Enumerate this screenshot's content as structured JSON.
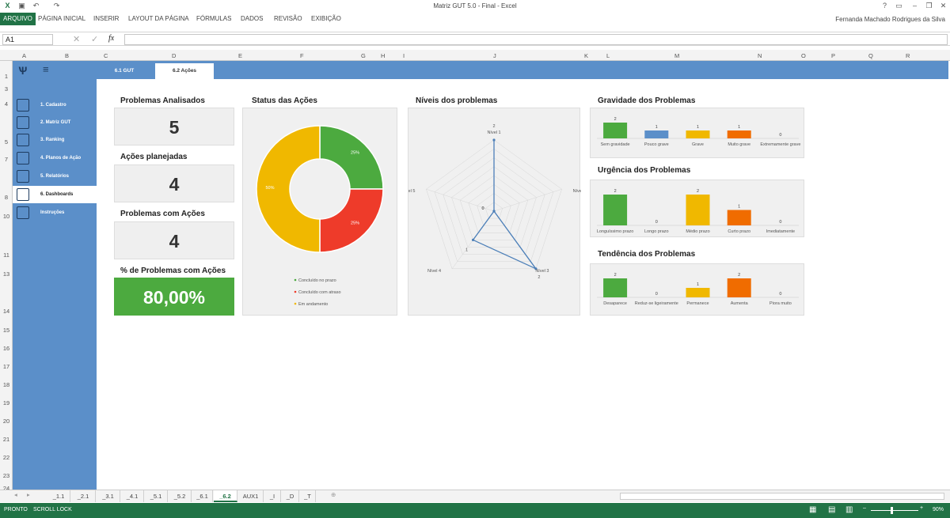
{
  "window": {
    "title": "Matriz GUT 5.0 - Final - Excel",
    "user": "Fernanda Machado Rodrigues da Silva"
  },
  "ribbon": {
    "tabs": [
      "ARQUIVO",
      "PÁGINA INICIAL",
      "INSERIR",
      "LAYOUT DA PÁGINA",
      "FÓRMULAS",
      "DADOS",
      "REVISÃO",
      "EXIBIÇÃO"
    ]
  },
  "formula_bar": {
    "name_box": "A1",
    "fx": "fx",
    "content": ""
  },
  "columns": [
    "A",
    "B",
    "C",
    "D",
    "E",
    "F",
    "G",
    "H",
    "I",
    "J",
    "K",
    "L",
    "M",
    "N",
    "O",
    "P",
    "Q",
    "R"
  ],
  "rows": [
    "1",
    "3",
    "4",
    "5",
    "7",
    "8",
    "10",
    "11",
    "13",
    "14",
    "15",
    "16",
    "17",
    "18",
    "19",
    "20",
    "21",
    "22",
    "23",
    "24"
  ],
  "sidebar": {
    "items": [
      {
        "label": "1. Cadastro",
        "icon": "register-icon"
      },
      {
        "label": "2. Matriz GUT",
        "icon": "matrix-icon"
      },
      {
        "label": "3. Ranking",
        "icon": "ranking-icon"
      },
      {
        "label": "4. Planos de Ação",
        "icon": "action-plan-icon"
      },
      {
        "label": "5. Relatórios",
        "icon": "report-icon"
      },
      {
        "label": "6. Dashboards",
        "icon": "dashboard-icon"
      },
      {
        "label": "Instruções",
        "icon": "instructions-icon"
      }
    ],
    "active_index": 5
  },
  "subtabs": [
    {
      "label": "6.1 GUT"
    },
    {
      "label": "6.2 Ações"
    }
  ],
  "subtab_active": 1,
  "kpis": {
    "analisados": {
      "title": "Problemas Analisados",
      "value": "5"
    },
    "planejadas": {
      "title": "Ações planejadas",
      "value": "4"
    },
    "com_acoes": {
      "title": "Problemas com Ações",
      "value": "4"
    },
    "pct": {
      "title": "% de Problemas com Ações",
      "value": "80,00%"
    }
  },
  "colors": {
    "green": "#4caa3f",
    "yellow": "#f0b800",
    "red": "#ee3b2a",
    "blue": "#5b8fc9",
    "orange": "#f06c00",
    "excel_green": "#217346"
  },
  "chart_data": [
    {
      "type": "pie",
      "title": "Status das Ações",
      "categories": [
        "Concluído no prazo",
        "Concluído com atraso",
        "Em andamento"
      ],
      "values": [
        25,
        25,
        50
      ],
      "value_labels": [
        "25%",
        "25%",
        "50%"
      ],
      "colors": [
        "#4caa3f",
        "#ee3b2a",
        "#f0b800"
      ],
      "legend": "bottom"
    },
    {
      "type": "radar",
      "title": "Níveis dos problemas",
      "categories": [
        "Nível 1",
        "Nível 2",
        "Nível 3",
        "Nível 4",
        "Nível 5"
      ],
      "values": [
        2,
        0,
        2,
        1,
        0
      ],
      "rlim": [
        0,
        2
      ]
    },
    {
      "type": "bar",
      "title": "Gravidade dos Problemas",
      "categories": [
        "Sem gravidade",
        "Pouco grave",
        "Grave",
        "Muito grave",
        "Extremamente grave"
      ],
      "values": [
        2,
        1,
        1,
        1,
        0
      ],
      "colors": [
        "#4caa3f",
        "#5b8fc9",
        "#f0b800",
        "#f06c00",
        "#ee3b2a"
      ],
      "ylim": [
        0,
        2
      ]
    },
    {
      "type": "bar",
      "title": "Urgência dos Problemas",
      "categories": [
        "Longuíssimo prazo",
        "Longo prazo",
        "Médio prazo",
        "Curto prazo",
        "Imediatamente"
      ],
      "values": [
        2,
        0,
        2,
        1,
        0
      ],
      "colors": [
        "#4caa3f",
        "#5b8fc9",
        "#f0b800",
        "#f06c00",
        "#ee3b2a"
      ],
      "ylim": [
        0,
        2
      ]
    },
    {
      "type": "bar",
      "title": "Tendência dos Problemas",
      "categories": [
        "Desaparece",
        "Reduz-se ligeiramente",
        "Permanece",
        "Aumenta",
        "Piora muito"
      ],
      "values": [
        2,
        0,
        1,
        2,
        0
      ],
      "colors": [
        "#4caa3f",
        "#5b8fc9",
        "#f0b800",
        "#f06c00",
        "#ee3b2a"
      ],
      "ylim": [
        0,
        2
      ]
    }
  ],
  "sheet_tabs": [
    "_1.1",
    "_2.1",
    "_3.1",
    "_4.1",
    "_5.1",
    "_5.2",
    "_6.1",
    "_6.2",
    "AUX1",
    "_I",
    "_D",
    "_T"
  ],
  "sheet_active": 7,
  "status": {
    "left1": "PRONTO",
    "left2": "SCROLL LOCK",
    "zoom": "90%"
  }
}
